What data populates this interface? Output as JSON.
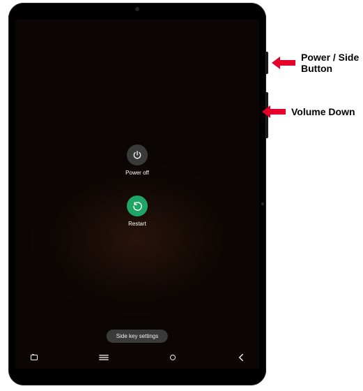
{
  "menu": {
    "power_off_label": "Power off",
    "restart_label": "Restart"
  },
  "pill_label": "Side key settings",
  "callouts": {
    "power_line1": "Power / Side",
    "power_line2": "Button",
    "volume_down": "Volume Down"
  },
  "icons": {
    "power": "power-icon",
    "restart": "restart-icon",
    "screenshot": "screenshot-icon",
    "recents": "recents-icon",
    "home": "home-icon",
    "back": "back-icon"
  }
}
